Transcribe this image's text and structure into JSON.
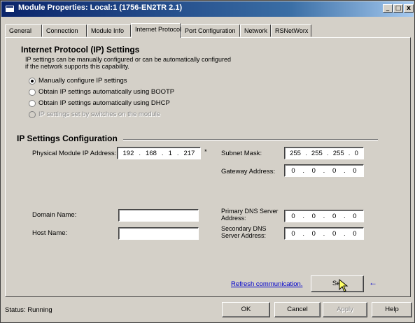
{
  "window": {
    "title": "Module Properties: Local:1 (1756-EN2TR 2.1)",
    "min_label": "_",
    "max_label": "□",
    "close_label": "x"
  },
  "tabs": [
    {
      "label": "General"
    },
    {
      "label": "Connection"
    },
    {
      "label": "Module Info"
    },
    {
      "label": "Internet Protocol",
      "active": true
    },
    {
      "label": "Port Configuration"
    },
    {
      "label": "Network"
    },
    {
      "label": "RSNetWorx"
    }
  ],
  "ip_settings": {
    "heading": "Internet Protocol (IP) Settings",
    "desc_line1": "IP settings can be manually configured or can be automatically configured",
    "desc_line2": "if the network supports this capability.",
    "options": [
      {
        "label": "Manually configure IP settings",
        "selected": true,
        "enabled": true
      },
      {
        "label": "Obtain IP settings automatically using BOOTP",
        "selected": false,
        "enabled": true
      },
      {
        "label": "Obtain IP settings automatically using DHCP",
        "selected": false,
        "enabled": true
      },
      {
        "label": "IP settings set by switches on the module",
        "selected": false,
        "enabled": false
      }
    ]
  },
  "config": {
    "heading": "IP Settings Configuration",
    "physical_ip_label": "Physical Module IP Address:",
    "physical_ip": [
      "192",
      "168",
      "1",
      "217"
    ],
    "required_mark": "*",
    "subnet_label": "Subnet Mask:",
    "subnet": [
      "255",
      "255",
      "255",
      "0"
    ],
    "gateway_label": "Gateway Address:",
    "gateway": [
      "0",
      "0",
      "0",
      "0"
    ],
    "domain_label": "Domain Name:",
    "domain_value": "",
    "host_label": "Host Name:",
    "host_value": "",
    "primary_dns_label_1": "Primary DNS Server",
    "primary_dns_label_2": "Address:",
    "primary_dns": [
      "0",
      "0",
      "0",
      "0"
    ],
    "secondary_dns_label_1": "Secondary DNS",
    "secondary_dns_label_2": "Server Address:",
    "secondary_dns": [
      "0",
      "0",
      "0",
      "0"
    ],
    "refresh_link": "Refresh communication.",
    "set_button": "Set",
    "arrow_glyph": "←"
  },
  "footer": {
    "status": "Status:  Running",
    "ok": "OK",
    "cancel": "Cancel",
    "apply": "Apply",
    "help": "Help"
  },
  "colors": {
    "titlebar_start": "#0a246a",
    "link": "#0000cc",
    "arrow": "#0000cc"
  }
}
